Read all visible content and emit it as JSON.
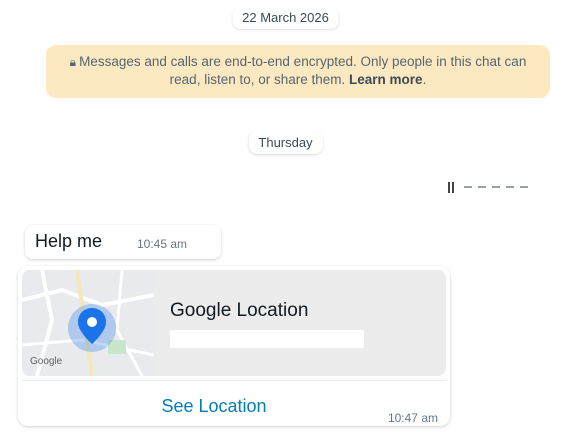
{
  "chat": {
    "date_label": "22 March 2026",
    "encryption": {
      "icon": "lock-icon",
      "text": "Messages and calls are end-to-end encrypted. Only people in this chat can read, listen to, or share them.",
      "link_label": "Learn more"
    },
    "day_label": "Thursday",
    "messages": [
      {
        "text": "Help me",
        "time": "10:45 am"
      },
      {
        "location": {
          "title": "Google Location",
          "map_attribution": "Google",
          "pin_icon": "location-pin-icon",
          "action_label": "See Location"
        },
        "time": "10:47 am"
      }
    ]
  },
  "colors": {
    "encryption_bg": "#fde9c1",
    "link": "#027eb5",
    "pin": "#1a73e8"
  }
}
